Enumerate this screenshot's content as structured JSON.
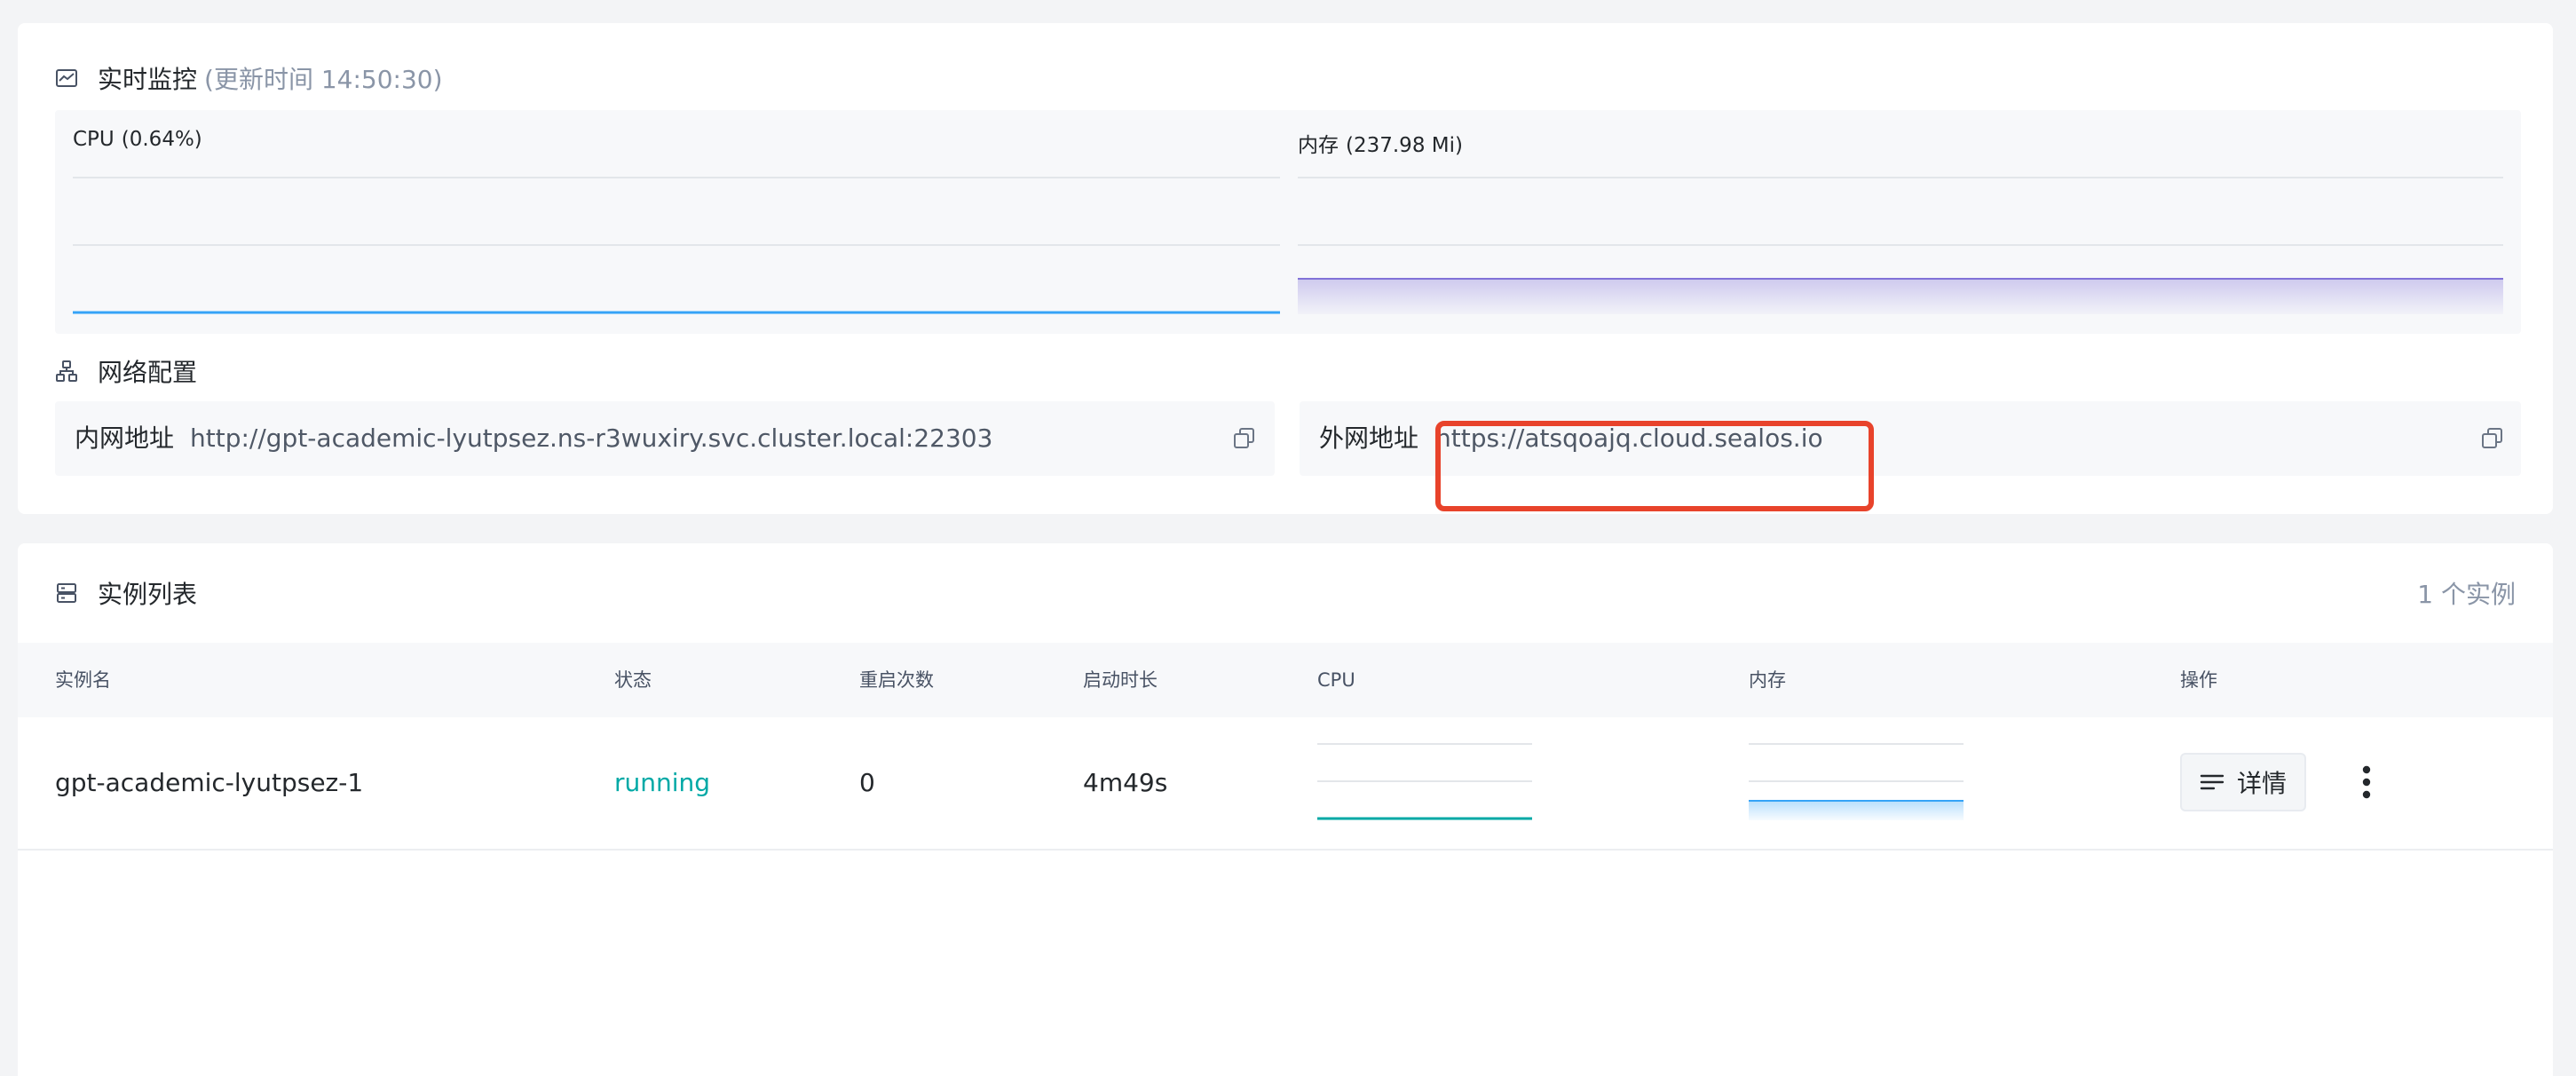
{
  "monitor": {
    "title": "实时监控",
    "updated": "(更新时间  14:50:30)",
    "cpu_label": "CPU",
    "cpu_value": "(0.64%)",
    "memory_label": "内存",
    "memory_value": "(237.98 Mi)",
    "cpu_line_color": "#36a3f7",
    "memory_line_color": "#8172d8"
  },
  "network": {
    "title": "网络配置",
    "internal_label": "内网地址",
    "internal_address": "http://gpt-academic-lyutpsez.ns-r3wuxiry.svc.cluster.local:22303",
    "external_label": "外网地址",
    "external_address": "https://atsqoajq.cloud.sealos.io",
    "highlight_color": "#e8432b"
  },
  "instances": {
    "title": "实例列表",
    "count": "1 个实例",
    "columns": [
      "实例名",
      "状态",
      "重启次数",
      "启动时长",
      "CPU",
      "内存",
      "操作"
    ],
    "rows": [
      {
        "name": "gpt-academic-lyutpsez-1",
        "status": "running",
        "restarts": "0",
        "uptime": "4m49s",
        "detail_label": "详情"
      }
    ],
    "status_color": "#00a9a6"
  }
}
